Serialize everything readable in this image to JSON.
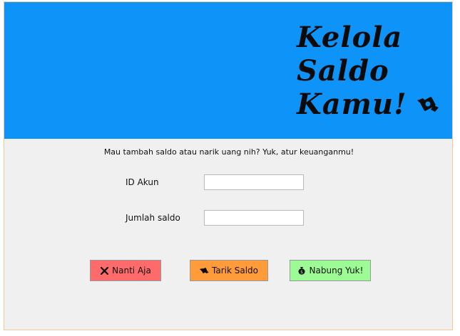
{
  "header": {
    "title_lines": [
      "Kelola",
      "Saldo",
      "Kamu!"
    ],
    "background": "#0e94f8",
    "icon": "money-wings-icon"
  },
  "form": {
    "subtitle": "Mau tambah saldo atau narik uang nih? Yuk, atur keuanganmu!",
    "account_id": {
      "label": "ID Akun",
      "value": ""
    },
    "balance": {
      "label": "Jumlah saldo",
      "value": ""
    }
  },
  "buttons": {
    "cancel": {
      "label": "Nanti Aja",
      "icon": "x-icon",
      "color": "#ff6b6b"
    },
    "withdraw": {
      "label": "Tarik Saldo",
      "icon": "money-wings-icon",
      "color": "#ff9b38"
    },
    "deposit": {
      "label": "Nabung Yuk!",
      "icon": "money-bag-icon",
      "color": "#9dfb95"
    }
  }
}
